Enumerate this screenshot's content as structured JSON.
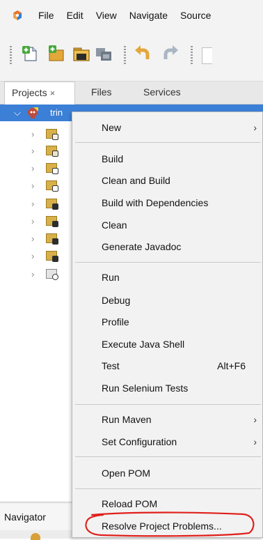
{
  "menubar": {
    "items": [
      "File",
      "Edit",
      "View",
      "Navigate",
      "Source"
    ]
  },
  "toolbar": {
    "icons": [
      "new-file-icon",
      "new-project-icon",
      "open-project-icon",
      "close-project-icon",
      "undo-icon",
      "redo-icon"
    ]
  },
  "tabs": {
    "projects": "Projects",
    "close": "×",
    "files": "Files",
    "services": "Services"
  },
  "tree": {
    "root_label": "trin"
  },
  "navigator": {
    "label": "Navigator"
  },
  "context_menu": {
    "items": [
      {
        "label": "New",
        "has_submenu": true
      },
      {
        "label": "Build"
      },
      {
        "label": "Clean and Build"
      },
      {
        "label": "Build with Dependencies"
      },
      {
        "label": "Clean"
      },
      {
        "label": "Generate Javadoc"
      },
      {
        "label": "Run"
      },
      {
        "label": "Debug"
      },
      {
        "label": "Profile"
      },
      {
        "label": "Execute Java Shell"
      },
      {
        "label": "Test",
        "shortcut": "Alt+F6"
      },
      {
        "label": "Run Selenium Tests"
      },
      {
        "label": "Run Maven",
        "has_submenu": true
      },
      {
        "label": "Set Configuration",
        "has_submenu": true
      },
      {
        "label": "Open POM"
      },
      {
        "label": "Reload POM"
      },
      {
        "label": "Resolve Project Problems..."
      }
    ],
    "submenu_glyph": "›"
  },
  "colors": {
    "selection": "#3b7fd6",
    "highlight_circle": "#e0201b"
  }
}
